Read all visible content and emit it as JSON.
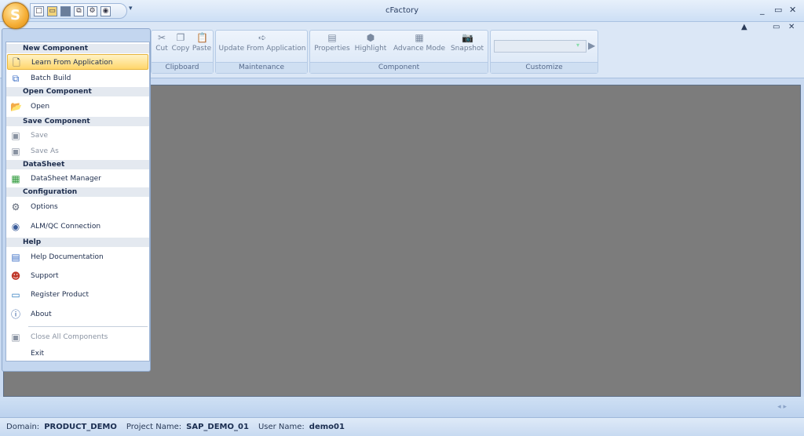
{
  "window": {
    "title": "cFactory",
    "controls": [
      "_",
      "▭",
      "✕"
    ],
    "ribbon_controls": [
      "▲",
      "▭",
      "✕"
    ]
  },
  "quick_access": {
    "icons": [
      "new-icon",
      "open-folder-icon",
      "save-icon",
      "copy-icon",
      "gear-icon",
      "connection-icon"
    ],
    "more": "▾"
  },
  "ribbon": {
    "groups": [
      {
        "label": "Clipboard",
        "buttons": [
          "Cut",
          "Copy",
          "Paste"
        ]
      },
      {
        "label": "Maintenance",
        "buttons": [
          "Update From Application"
        ]
      },
      {
        "label": "Component",
        "buttons": [
          "Properties",
          "Highlight",
          "Advance Mode",
          "Snapshot"
        ]
      },
      {
        "label": "Customize",
        "buttons": []
      }
    ]
  },
  "app_menu": {
    "sections": [
      {
        "header": "New Component",
        "items": [
          {
            "label": "Learn From Application",
            "icon": "new-document-icon",
            "active": true,
            "disabled": false
          },
          {
            "label": "Batch Build",
            "icon": "batch-build-icon",
            "active": false,
            "disabled": false
          }
        ]
      },
      {
        "header": "Open Component",
        "items": [
          {
            "label": "Open",
            "icon": "open-folder-icon",
            "active": false,
            "disabled": false
          }
        ]
      },
      {
        "header": "Save Component",
        "items": [
          {
            "label": "Save",
            "icon": "save-icon",
            "active": false,
            "disabled": true
          },
          {
            "label": "Save As",
            "icon": "save-as-icon",
            "active": false,
            "disabled": true
          }
        ]
      },
      {
        "header": "DataSheet",
        "items": [
          {
            "label": "DataSheet Manager",
            "icon": "datasheet-icon",
            "active": false,
            "disabled": false
          }
        ]
      },
      {
        "header": "Configuration",
        "items": [
          {
            "label": "Options",
            "icon": "gear-icon",
            "active": false,
            "disabled": false
          },
          {
            "label": "ALM/QC Connection",
            "icon": "connection-icon",
            "active": false,
            "disabled": false
          }
        ]
      },
      {
        "header": "Help",
        "items": [
          {
            "label": "Help Documentation",
            "icon": "document-icon",
            "active": false,
            "disabled": false
          },
          {
            "label": "Support",
            "icon": "support-person-icon",
            "active": false,
            "disabled": false
          },
          {
            "label": "Register Product",
            "icon": "register-icon",
            "active": false,
            "disabled": false
          },
          {
            "label": "About",
            "icon": "info-icon",
            "active": false,
            "disabled": false
          }
        ]
      }
    ],
    "footer_items": [
      {
        "label": "Close All Components",
        "icon": "close-all-icon",
        "disabled": true
      },
      {
        "label": "Exit",
        "icon": "",
        "disabled": false
      }
    ]
  },
  "status": {
    "domain_label": "Domain:",
    "domain_value": "PRODUCT_DEMO",
    "project_label": "Project Name:",
    "project_value": "SAP_DEMO_01",
    "user_label": "User Name:",
    "user_value": "demo01"
  }
}
